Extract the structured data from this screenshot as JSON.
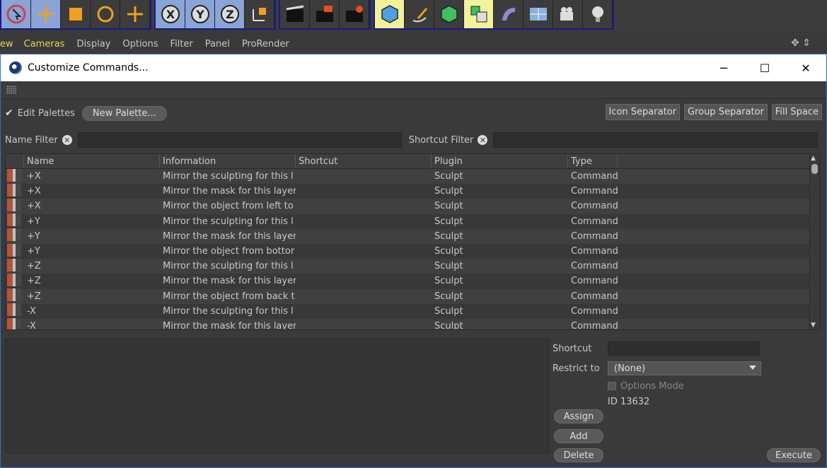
{
  "toolbar": {
    "groups": [
      [
        "select-tool",
        "move-tool",
        "scale-tool",
        "rotate-tool",
        "recent-tool"
      ],
      [
        "x-axis-lock",
        "y-axis-lock",
        "z-axis-lock",
        "coordinate-system"
      ],
      [
        "render-view",
        "render-picture-viewer",
        "render-settings"
      ],
      [
        "cube-object",
        "pen-spline",
        "subdivision-surface",
        "array-generator",
        "deformer",
        "floor-object",
        "camera-object",
        "light-object"
      ]
    ]
  },
  "menu": {
    "items": [
      "ew",
      "Cameras",
      "Display",
      "Options",
      "Filter",
      "Panel",
      "ProRender"
    ],
    "active_index": 1
  },
  "dialog": {
    "title": "Customize Commands...",
    "edit_palettes_label": "Edit Palettes",
    "new_palette_label": "New Palette...",
    "icon_separator_label": "Icon Separator",
    "group_separator_label": "Group Separator",
    "fill_space_label": "Fill Space",
    "name_filter_label": "Name Filter",
    "shortcut_filter_label": "Shortcut Filter",
    "name_filter_value": "",
    "shortcut_filter_value": ""
  },
  "table": {
    "headers": [
      "Name",
      "Information",
      "Shortcut",
      "Plugin",
      "Type"
    ],
    "rows": [
      {
        "name": "+X",
        "info": "Mirror the sculpting for this l",
        "shortcut": "",
        "plugin": "Sculpt",
        "type": "Command"
      },
      {
        "name": "+X",
        "info": "Mirror the mask for this layer",
        "shortcut": "",
        "plugin": "Sculpt",
        "type": "Command"
      },
      {
        "name": "+X",
        "info": "Mirror the object from left to",
        "shortcut": "",
        "plugin": "Sculpt",
        "type": "Command"
      },
      {
        "name": "+Y",
        "info": "Mirror the sculpting for this l",
        "shortcut": "",
        "plugin": "Sculpt",
        "type": "Command"
      },
      {
        "name": "+Y",
        "info": "Mirror the mask for this layer",
        "shortcut": "",
        "plugin": "Sculpt",
        "type": "Command"
      },
      {
        "name": "+Y",
        "info": "Mirror the object from bottor",
        "shortcut": "",
        "plugin": "Sculpt",
        "type": "Command"
      },
      {
        "name": "+Z",
        "info": "Mirror the sculpting for this l",
        "shortcut": "",
        "plugin": "Sculpt",
        "type": "Command"
      },
      {
        "name": "+Z",
        "info": "Mirror the mask for this layer",
        "shortcut": "",
        "plugin": "Sculpt",
        "type": "Command"
      },
      {
        "name": "+Z",
        "info": "Mirror the object from back t",
        "shortcut": "",
        "plugin": "Sculpt",
        "type": "Command"
      },
      {
        "name": "-X",
        "info": "Mirror the sculpting for this l",
        "shortcut": "",
        "plugin": "Sculpt",
        "type": "Command"
      },
      {
        "name": "-X",
        "info": "Mirror the mask for this layer",
        "shortcut": "",
        "plugin": "Sculpt",
        "type": "Command"
      }
    ]
  },
  "details": {
    "shortcut_label": "Shortcut",
    "restrict_label": "Restrict to",
    "restrict_value": "(None)",
    "options_mode_label": "Options Mode",
    "id_text": "ID 13632",
    "assign_label": "Assign",
    "add_label": "Add",
    "delete_label": "Delete",
    "execute_label": "Execute"
  },
  "colors": {
    "accent_border": "#2b73c9",
    "active_menu": "#e8d060",
    "toolbar_highlight": "#8aa4d8"
  }
}
